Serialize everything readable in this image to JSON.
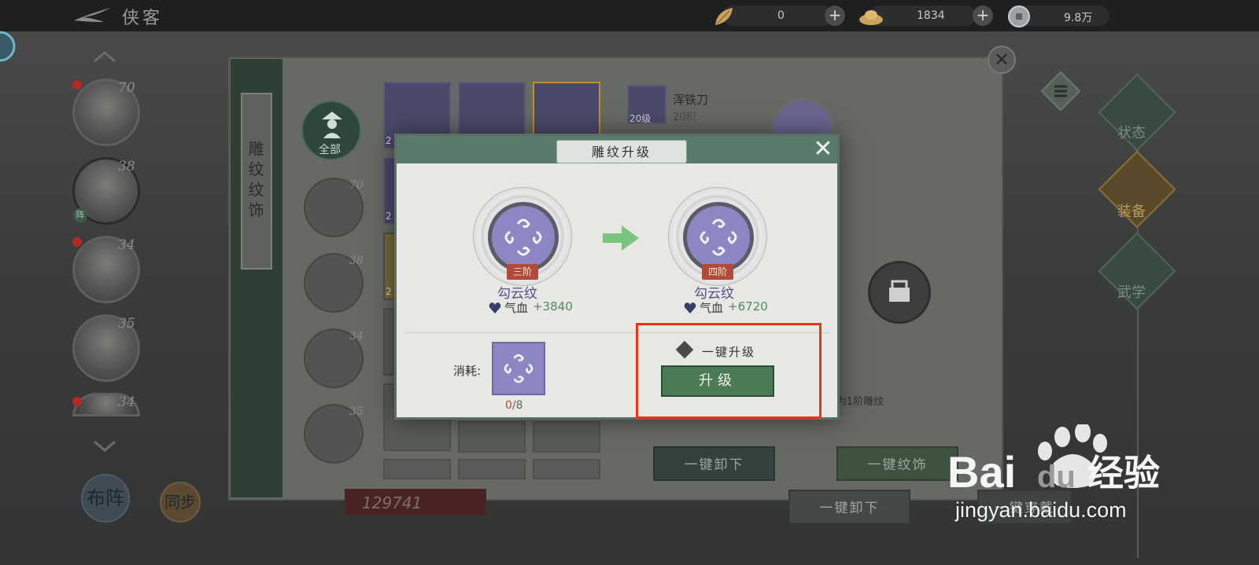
{
  "topbar": {
    "title": "侠客",
    "resources": [
      {
        "icon": "leaf-currency-icon",
        "value": "0"
      },
      {
        "icon": "gold-ingot-icon",
        "value": "1834"
      },
      {
        "icon": "coin-icon",
        "value": "9.8万"
      }
    ]
  },
  "roster": {
    "levels": [
      "70",
      "38",
      "34",
      "35",
      "34"
    ]
  },
  "side_tab": {
    "label": "雕纹纹饰"
  },
  "categories": {
    "all_label": "全部",
    "levels": [
      "70",
      "38",
      "34",
      "35"
    ]
  },
  "grid": {
    "item_levels": [
      "2",
      "2",
      "2",
      "2",
      "2"
    ]
  },
  "equipped": {
    "name": "浑铁刀",
    "level": "20级",
    "sub": "20积"
  },
  "panel": {
    "hint": "为1阶雕纹",
    "unload_label": "一键卸下",
    "adorn_label": "一键纹饰",
    "unload2_label": "一键卸下",
    "wear_label": "一键穿戴",
    "power": "129741"
  },
  "right_tabs": [
    "状态",
    "装备",
    "武学"
  ],
  "corner_buttons": {
    "formation": "布阵",
    "sync": "同步"
  },
  "dialog": {
    "title": "雕纹升级",
    "from": {
      "tier": "三阶",
      "name": "勾云纹",
      "stat_label": "气血",
      "stat_value": "+3840"
    },
    "to": {
      "tier": "四阶",
      "name": "勾云纹",
      "stat_label": "气血",
      "stat_value": "+6720"
    },
    "consume_label": "消耗:",
    "consume_have": "0",
    "consume_need": "/8",
    "onekey_label": "一键升级",
    "upgrade_label": "升级"
  },
  "watermark": {
    "brand": "Baidu经验",
    "url": "jingyan.baidu.com"
  },
  "colors": {
    "dialog_header": "#5a7b6b",
    "upgrade_button": "#4b7b55",
    "highlight_box": "#e8341c",
    "stat_value": "#4d8c60",
    "tier_badge": "#b04b3b",
    "pattern_fill": "#8c86c2"
  }
}
